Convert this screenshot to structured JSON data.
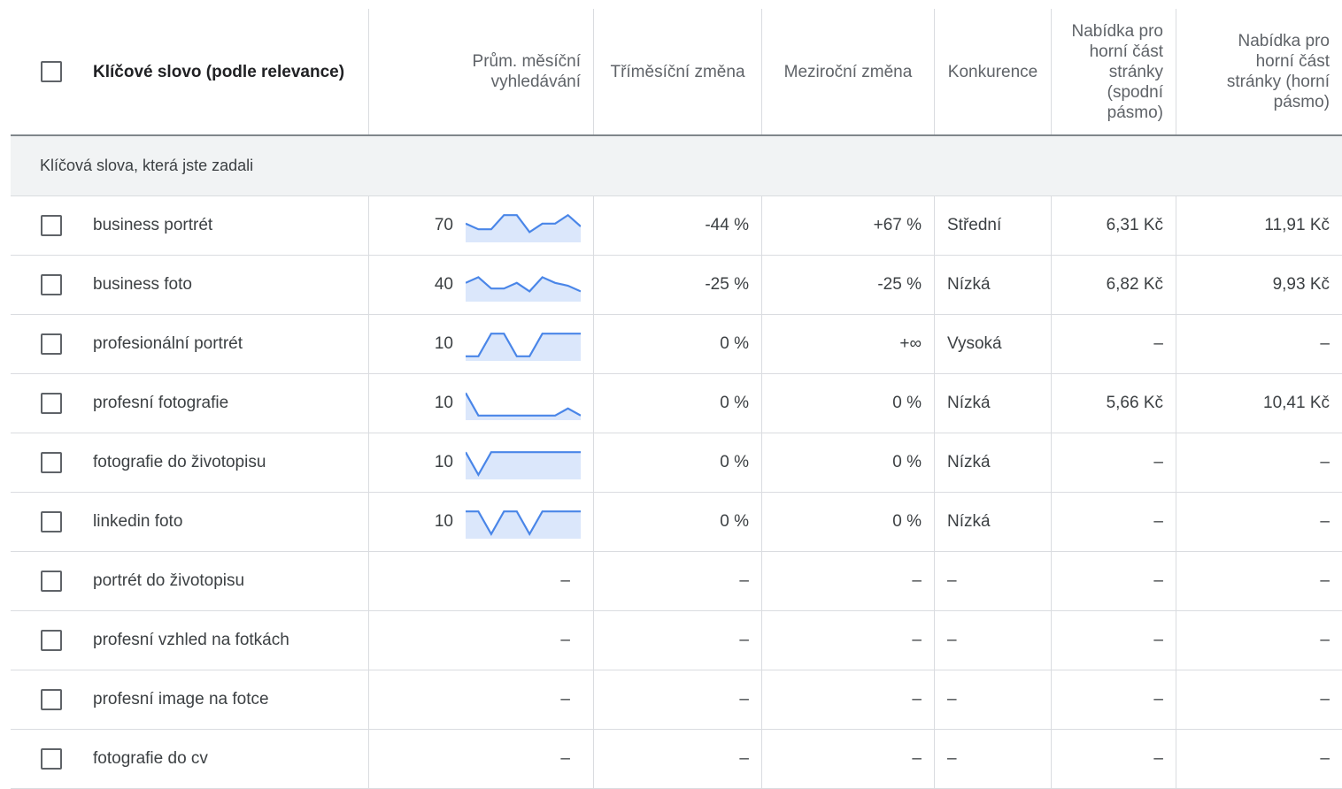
{
  "header": {
    "keyword": "Klíčové slovo (podle relevance)",
    "avg_searches": "Prům. měsíční vyhledávání",
    "three_month_change": "Tříměsíční změna",
    "yoy_change": "Meziroční změna",
    "competition": "Konkurence",
    "bid_low": "Nabídka pro horní část stránky (spodní pásmo)",
    "bid_high": "Nabídka pro horní část stránky (horní pásmo)"
  },
  "group_label": "Klíčová slova, která jste zadali",
  "rows": [
    {
      "keyword": "business portrét",
      "avg": "70",
      "trend": [
        0.6,
        0.4,
        0.4,
        0.9,
        0.9,
        0.3,
        0.6,
        0.6,
        0.9,
        0.5
      ],
      "three_month": "-44 %",
      "yoy": "+67 %",
      "competition": "Střední",
      "bid_low": "6,31 Kč",
      "bid_high": "11,91 Kč"
    },
    {
      "keyword": "business foto",
      "avg": "40",
      "trend": [
        0.6,
        0.8,
        0.4,
        0.4,
        0.6,
        0.3,
        0.8,
        0.6,
        0.5,
        0.3
      ],
      "three_month": "-25 %",
      "yoy": "-25 %",
      "competition": "Nízká",
      "bid_low": "6,82 Kč",
      "bid_high": "9,93 Kč"
    },
    {
      "keyword": "profesionální portrét",
      "avg": "10",
      "trend": [
        0.1,
        0.1,
        0.9,
        0.9,
        0.1,
        0.1,
        0.9,
        0.9,
        0.9,
        0.9
      ],
      "three_month": "0 %",
      "yoy": "+∞",
      "competition": "Vysoká",
      "bid_low": "–",
      "bid_high": "–"
    },
    {
      "keyword": "profesní fotografie",
      "avg": "10",
      "trend": [
        0.9,
        0.1,
        0.1,
        0.1,
        0.1,
        0.1,
        0.1,
        0.1,
        0.35,
        0.1
      ],
      "three_month": "0 %",
      "yoy": "0 %",
      "competition": "Nízká",
      "bid_low": "5,66 Kč",
      "bid_high": "10,41 Kč"
    },
    {
      "keyword": "fotografie do životopisu",
      "avg": "10",
      "trend": [
        0.9,
        0.1,
        0.9,
        0.9,
        0.9,
        0.9,
        0.9,
        0.9,
        0.9,
        0.9
      ],
      "three_month": "0 %",
      "yoy": "0 %",
      "competition": "Nízká",
      "bid_low": "–",
      "bid_high": "–"
    },
    {
      "keyword": "linkedin foto",
      "avg": "10",
      "trend": [
        0.9,
        0.9,
        0.1,
        0.9,
        0.9,
        0.1,
        0.9,
        0.9,
        0.9,
        0.9
      ],
      "three_month": "0 %",
      "yoy": "0 %",
      "competition": "Nízká",
      "bid_low": "–",
      "bid_high": "–"
    },
    {
      "keyword": "portrét do životopisu",
      "avg": "–",
      "trend": null,
      "three_month": "–",
      "yoy": "–",
      "competition": "–",
      "bid_low": "–",
      "bid_high": "–"
    },
    {
      "keyword": "profesní vzhled na fotkách",
      "avg": "–",
      "trend": null,
      "three_month": "–",
      "yoy": "–",
      "competition": "–",
      "bid_low": "–",
      "bid_high": "–"
    },
    {
      "keyword": "profesní image na fotce",
      "avg": "–",
      "trend": null,
      "three_month": "–",
      "yoy": "–",
      "competition": "–",
      "bid_low": "–",
      "bid_high": "–"
    },
    {
      "keyword": "fotografie do cv",
      "avg": "–",
      "trend": null,
      "three_month": "–",
      "yoy": "–",
      "competition": "–",
      "bid_low": "–",
      "bid_high": "–"
    }
  ],
  "colors": {
    "trend_line": "#4a86e8",
    "trend_fill": "#dbe7fb"
  }
}
